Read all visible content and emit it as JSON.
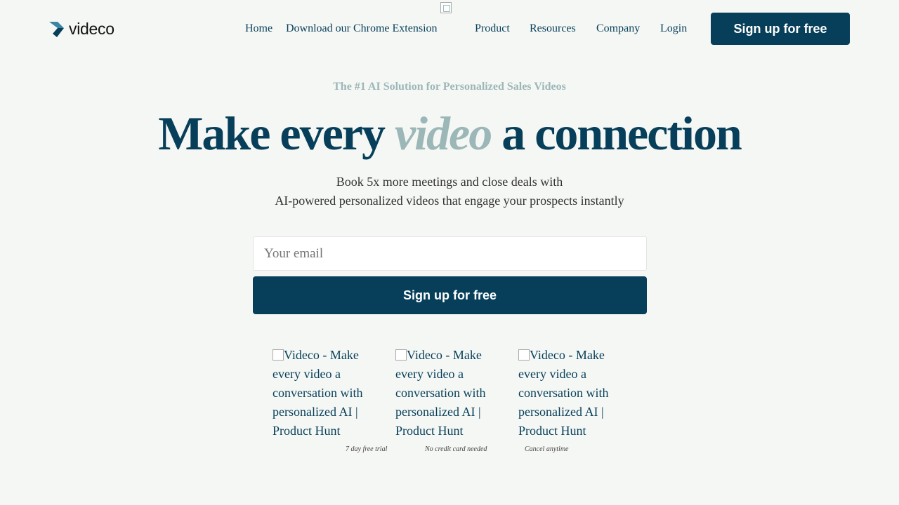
{
  "brand": {
    "name": "videco",
    "logo_icon": "chevron-arrow-icon",
    "accent_color": "#073f5a",
    "muted_color": "#9cb7b8"
  },
  "nav": {
    "home": "Home",
    "extension": "Download our Chrome Extension",
    "product": "Product",
    "resources": "Resources",
    "company": "Company",
    "login": "Login",
    "signup": "Sign up for free"
  },
  "hero": {
    "eyebrow": "The #1 AI Solution for Personalized Sales Videos",
    "headline_before": "Make every ",
    "headline_accent": "video",
    "headline_after": " a connection",
    "sub_line1": "Book 5x more meetings and close deals with",
    "sub_line2": "AI-powered personalized videos that engage your prospects instantly"
  },
  "form": {
    "email_placeholder": "Your email",
    "email_value": "",
    "submit": "Sign up for free"
  },
  "badges": [
    {
      "alt": "Videco - Make every video a conversation with personalized AI | Product Hunt"
    },
    {
      "alt": "Videco - Make every video a conversation with personalized AI | Product Hunt"
    },
    {
      "alt": "Videco - Make every video a conversation with personalized AI | Product Hunt"
    }
  ],
  "notes": [
    "7 day free trial",
    "No credit card needed",
    "Cancel anytime"
  ]
}
